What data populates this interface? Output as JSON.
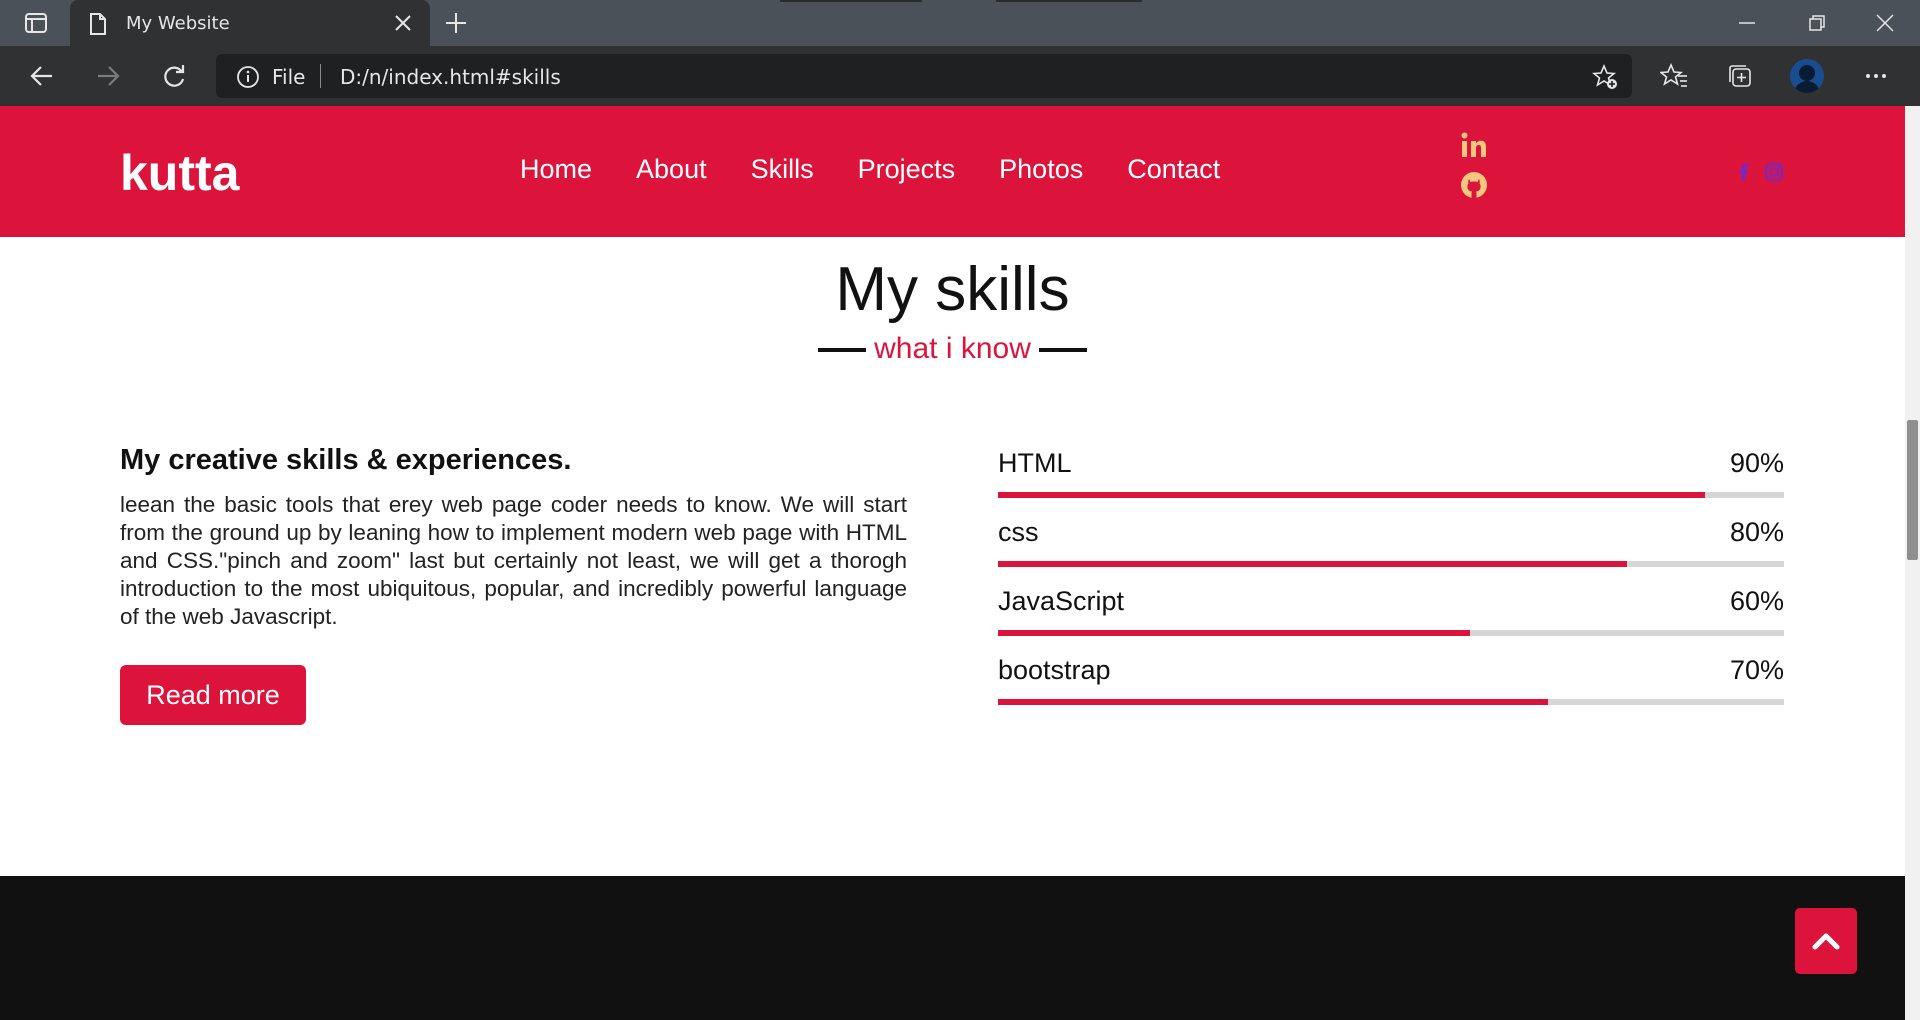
{
  "browser": {
    "tab_title": "My Website",
    "omnibox": {
      "scheme_label": "File",
      "url": "D:/n/index.html#skills"
    }
  },
  "site": {
    "logo": "kutta",
    "menu": [
      "Home",
      "About",
      "Skills",
      "Projects",
      "Photos",
      "Contact"
    ],
    "social_icons": [
      "linkedin-icon",
      "github-icon",
      "facebook-icon",
      "instagram-icon"
    ]
  },
  "skills": {
    "title": "My skills",
    "subtitle": "what i know",
    "heading": "My creative skills & experiences.",
    "text": "leean the basic tools that erey web page coder needs to know. We will start from the ground up by leaning how to implement modern web page with HTML and CSS.\"pinch and zoom\" last but certainly not least, we will get a thorogh introduction to the most ubiquitous, popular, and incredibly powerful language of the web Javascript.",
    "button": "Read more",
    "bars": [
      {
        "name": "HTML",
        "percent": "90%",
        "value": 90
      },
      {
        "name": "css",
        "percent": "80%",
        "value": 80
      },
      {
        "name": "JavaScript",
        "percent": "60%",
        "value": 60
      },
      {
        "name": "bootstrap",
        "percent": "70%",
        "value": 70
      }
    ]
  },
  "colors": {
    "accent": "#dc143c",
    "footer": "#111111",
    "chrome": "#2f3133"
  }
}
